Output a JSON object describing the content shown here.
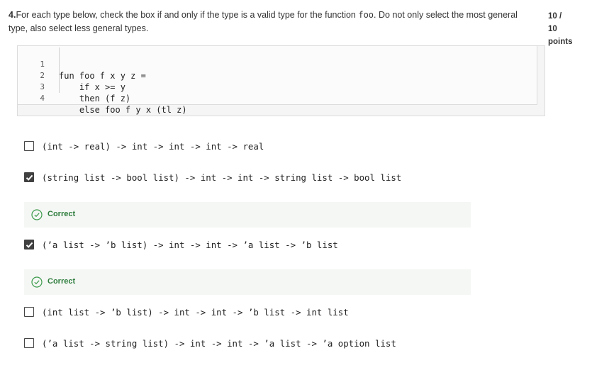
{
  "question": {
    "number": "4.",
    "text_before": "For each type below, check the box if and only if the type is a valid type for the function ",
    "function_name": "foo",
    "text_after": ". Do not only select the most general type, also select less general types."
  },
  "points": {
    "earned": "10 /",
    "possible": "10",
    "label": "points"
  },
  "code": {
    "lines": [
      {
        "num": "1",
        "text": "fun foo f x y z ="
      },
      {
        "num": "2",
        "text": "    if x >= y"
      },
      {
        "num": "3",
        "text": "    then (f z)"
      },
      {
        "num": "4",
        "text": "    else foo f y x (tl z)"
      }
    ]
  },
  "options": [
    {
      "label": "(int -> real) -> int -> int -> int -> real",
      "checked": false
    },
    {
      "label": "(string list -> bool list) -> int -> int -> string list -> bool list",
      "checked": true,
      "feedback": "Correct"
    },
    {
      "label": "(’a list -> ’b list) -> int -> int -> ’a list -> ’b list",
      "checked": true,
      "feedback": "Correct"
    },
    {
      "label": "(int list -> ’b list) -> int -> int -> ’b list -> int list",
      "checked": false
    },
    {
      "label": "(’a list -> string list) -> int -> int -> ’a list -> ’a option list",
      "checked": false
    }
  ],
  "colors": {
    "correct_text": "#2e7d3c",
    "feedback_bg": "#f5f7f5",
    "checkbox_checked": "#404040"
  }
}
